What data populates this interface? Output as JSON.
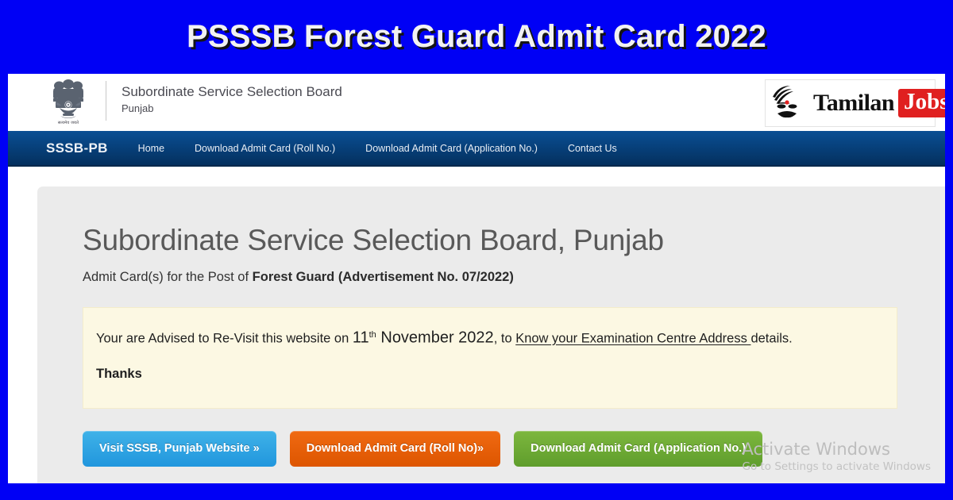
{
  "banner": {
    "title": "PSSSB Forest Guard Admit Card 2022",
    "background_color": "#0000f5",
    "text_color": "#f2f2f2"
  },
  "site_header": {
    "emblem_icon": "india-national-emblem-icon",
    "emblem_motto": "सत्यमेव जयते",
    "org_name": "Subordinate Service Selection Board",
    "org_state": "Punjab",
    "logo": {
      "face_icon": "tamilan-face-icon",
      "word_primary": "Tamilan",
      "word_badge": "Jobs",
      "badge_color": "#e02020"
    }
  },
  "navbar": {
    "brand": "SSSB-PB",
    "background_color": "#07417c",
    "items": [
      {
        "label": "Home"
      },
      {
        "label": "Download Admit Card (Roll No.)"
      },
      {
        "label": "Download Admit Card (Application No.)"
      },
      {
        "label": "Contact Us"
      }
    ]
  },
  "main": {
    "heading": "Subordinate Service Selection Board, Punjab",
    "subheading_prefix": "Admit Card(s) for the Post of ",
    "subheading_bold": "Forest Guard (Advertisement No. 07/2022)",
    "notice": {
      "background_color": "#fcf8e3",
      "text_part1": "Your are Advised to Re-Visit this website on ",
      "date_number": "11",
      "date_ordinal": "th",
      "date_month_year": " November 2022",
      "text_part2": ", to ",
      "link_text": "Know your Examination Centre Address ",
      "text_part3": "details.",
      "thanks": "Thanks"
    },
    "buttons": [
      {
        "label": "Visit SSSB, Punjab Website »",
        "color": "#2196dd"
      },
      {
        "label": "Download Admit Card (Roll No)»",
        "color": "#dd5500"
      },
      {
        "label": "Download Admit Card (Application No.)",
        "color": "#5f9d2c"
      }
    ]
  },
  "watermark": {
    "line1": "Activate Windows",
    "line2": "Go to Settings to activate Windows"
  }
}
